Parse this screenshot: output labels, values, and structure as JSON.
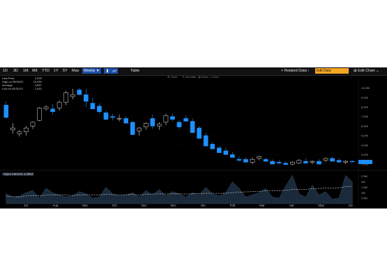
{
  "toolbar": {
    "ranges": [
      "1D",
      "3D",
      "1M",
      "6M",
      "YTD",
      "1Y",
      "5Y",
      "Max"
    ],
    "period": "Weekly ▼",
    "table": "Table",
    "related": "+ Related Data ›",
    "edit_chart": "⊞ Edit Chart ⌄",
    "search_placeholder": "Edit Data"
  },
  "subbar": {
    "items": [
      "Track",
      "Annotate",
      "News",
      "Zoom"
    ]
  },
  "legend": [
    {
      "label": "Last Price",
      "value": "2,228"
    },
    {
      "label": "High on 08/26/22",
      "value": "10,039"
    },
    {
      "label": "Average",
      "value": "4,967"
    },
    {
      "label": "Low on 05/31/23",
      "value": "1,944"
    }
  ],
  "open_interest": "Open Interest 4,2984",
  "colors": {
    "up": "#1e90ff",
    "down": "#000000",
    "outline": "#e0e0e0",
    "bg": "#000000",
    "oi_fill": "#1a2a3a",
    "oi_line": "#aaaaaa"
  },
  "chart_data": {
    "type": "candlestick",
    "x_labels": [
      "Jul",
      "Aug",
      "Sep",
      "Oct",
      "Nov",
      "Dec",
      "Jan",
      "Feb",
      "Mar",
      "Apr",
      "May",
      "Jun"
    ],
    "y_ticks": [
      "10,000",
      "9,000",
      "8,000",
      "7,000",
      "6,000",
      "5,000",
      "4,000",
      "3,000",
      "2,000"
    ],
    "ylim": [
      1500,
      10700
    ],
    "candles": [
      [
        8200,
        8600,
        6800,
        6900
      ],
      [
        5600,
        6300,
        5200,
        5800
      ],
      [
        5200,
        5600,
        4900,
        5400
      ],
      [
        5400,
        6000,
        5000,
        5800
      ],
      [
        6000,
        6500,
        5700,
        6400
      ],
      [
        6600,
        8000,
        6500,
        7900
      ],
      [
        7800,
        8200,
        7600,
        8000
      ],
      [
        7800,
        8300,
        7200,
        7500
      ],
      [
        7900,
        8700,
        7600,
        8500
      ],
      [
        8500,
        9700,
        8200,
        9500
      ],
      [
        9100,
        9900,
        8800,
        9300
      ],
      [
        9800,
        10000,
        9300,
        9300
      ],
      [
        9300,
        9900,
        8000,
        8600
      ],
      [
        8400,
        9000,
        7900,
        7800
      ],
      [
        8100,
        8400,
        7300,
        7500
      ],
      [
        7400,
        7600,
        6600,
        6700
      ],
      [
        7000,
        7300,
        6600,
        6900
      ],
      [
        6800,
        7200,
        6500,
        6800
      ],
      [
        6800,
        7000,
        6500,
        6300
      ],
      [
        6400,
        6500,
        5200,
        5100
      ],
      [
        5500,
        5900,
        5000,
        5800
      ],
      [
        5900,
        6400,
        5600,
        6300
      ],
      [
        6800,
        7200,
        5700,
        6000
      ],
      [
        6000,
        6400,
        5600,
        6200
      ],
      [
        6400,
        7300,
        6100,
        7100
      ],
      [
        7000,
        7300,
        6500,
        6700
      ],
      [
        6400,
        6600,
        5700,
        5900
      ],
      [
        6800,
        7100,
        6500,
        6500
      ],
      [
        6500,
        6800,
        5300,
        5300
      ],
      [
        5800,
        6000,
        5500,
        4700
      ],
      [
        5000,
        5300,
        4300,
        3900
      ],
      [
        4100,
        4300,
        3700,
        3600
      ],
      [
        3700,
        3900,
        3200,
        3200
      ],
      [
        3400,
        3700,
        3100,
        3000
      ],
      [
        3000,
        3300,
        2800,
        2700
      ],
      [
        2500,
        2800,
        2300,
        2400
      ],
      [
        2500,
        2700,
        2300,
        2200
      ],
      [
        2200,
        2700,
        2000,
        2500
      ],
      [
        2600,
        2900,
        2400,
        2800
      ],
      [
        2500,
        2700,
        2200,
        2300
      ],
      [
        2300,
        2500,
        2100,
        2000
      ],
      [
        2200,
        2400,
        2000,
        2100
      ],
      [
        2100,
        2300,
        1950,
        1944
      ],
      [
        2000,
        2300,
        1900,
        2200
      ],
      [
        2100,
        2500,
        2000,
        2400
      ],
      [
        2300,
        2600,
        2100,
        2100
      ],
      [
        2200,
        2400,
        2000,
        2300
      ],
      [
        2300,
        2500,
        2100,
        2000
      ],
      [
        2400,
        2700,
        2200,
        2600
      ],
      [
        2600,
        2800,
        2400,
        2300
      ],
      [
        2400,
        2600,
        2200,
        2200
      ],
      [
        2200,
        2400,
        2000,
        2300
      ],
      [
        2300,
        2400,
        2200,
        2228
      ]
    ],
    "oi_ticks": [
      "2.5M",
      "2M",
      "1.5M",
      "1M",
      "0.5M"
    ],
    "oi_ylim": [
      0,
      2.8
    ],
    "open_interest_area": [
      0.9,
      0.6,
      0.7,
      1.0,
      1.2,
      0.5,
      1.4,
      1.0,
      0.8,
      0.6,
      0.7,
      1.1,
      0.9,
      0.5,
      0.6,
      1.5,
      0.9,
      0.7,
      0.8,
      1.0,
      0.6,
      1.2,
      0.8,
      1.3,
      0.7,
      1.1,
      0.9,
      0.6,
      1.0,
      0.8,
      1.5,
      0.9,
      0.7,
      1.0,
      2.0,
      1.4,
      0.6,
      0.8,
      1.0,
      1.4,
      0.6,
      0.5,
      1.6,
      2.6,
      0.9,
      0.6,
      1.7,
      0.8,
      1.1,
      0.4,
      0.5,
      2.6,
      2.0
    ],
    "open_interest_avg": [
      0.7,
      0.65,
      0.6,
      0.7,
      0.75,
      0.72,
      0.78,
      0.8,
      0.8,
      0.78,
      0.75,
      0.8,
      0.82,
      0.8,
      0.8,
      0.85,
      0.83,
      0.8,
      0.82,
      0.84,
      0.8,
      0.85,
      0.88,
      0.9,
      0.88,
      0.9,
      0.9,
      0.88,
      0.9,
      0.92,
      0.95,
      0.95,
      0.94,
      0.96,
      1.0,
      1.05,
      1.08,
      1.1,
      1.12,
      1.18,
      1.2,
      1.18,
      1.22,
      1.3,
      1.32,
      1.3,
      1.36,
      1.38,
      1.42,
      1.4,
      1.45,
      1.55,
      1.6
    ]
  }
}
